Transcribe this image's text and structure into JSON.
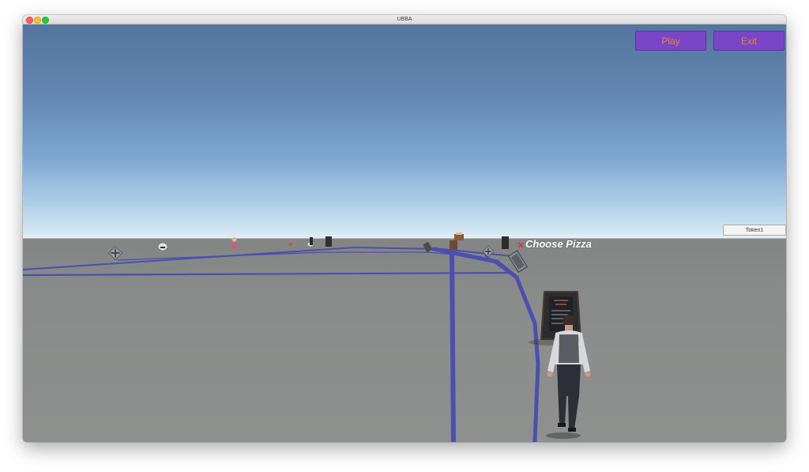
{
  "window": {
    "title": "UBBA"
  },
  "hud": {
    "play_label": "Play",
    "exit_label": "Exit",
    "token_value": "Token1",
    "world_label": "Choose Pizza"
  },
  "colors": {
    "button_bg": "#7a45c7",
    "button_text": "#e38a2a",
    "path_line": "#4a4fb0",
    "sky_top": "#53759e",
    "horizon": "#dcecf4",
    "ground": "#8a8c8b"
  },
  "icons": {
    "window_controls": [
      "close-icon",
      "minimize-icon",
      "maximize-icon"
    ],
    "world_marker": "x-marker-icon"
  }
}
